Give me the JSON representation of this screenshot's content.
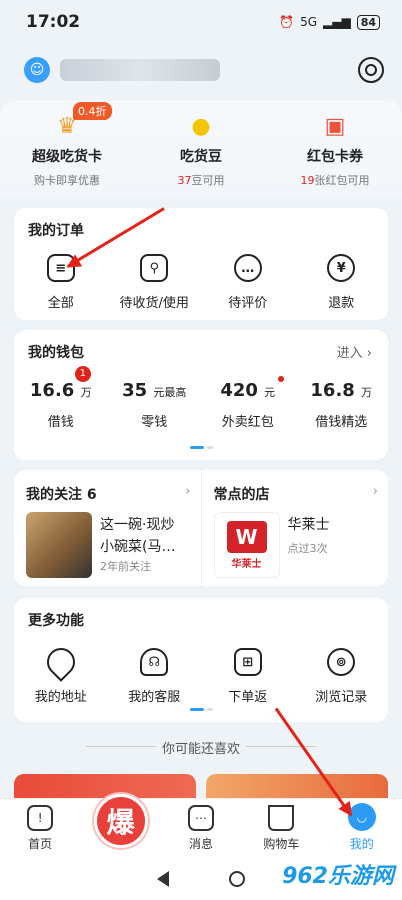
{
  "status": {
    "time": "17:02",
    "battery": "84",
    "network": "5G"
  },
  "benefits": [
    {
      "title": "超级吃货卡",
      "sub": "购卡即享优惠",
      "tag": "0.4折",
      "icon": "crown-icon",
      "glyph": "♛"
    },
    {
      "title": "吃货豆",
      "num": "37",
      "suffix": "豆可用",
      "icon": "bean-icon",
      "glyph": "●"
    },
    {
      "title": "红包卡券",
      "num": "19",
      "suffix": "张红包可用",
      "icon": "coupon-icon",
      "glyph": "▣"
    }
  ],
  "orders": {
    "title": "我的订单",
    "items": [
      {
        "label": "全部",
        "glyph": "≡",
        "icon": "order-list-icon"
      },
      {
        "label": "待收货/使用",
        "glyph": "⚲",
        "icon": "delivery-scooter-icon"
      },
      {
        "label": "待评价",
        "glyph": "…",
        "icon": "comment-icon"
      },
      {
        "label": "退款",
        "glyph": "¥",
        "icon": "refund-icon"
      }
    ]
  },
  "wallet": {
    "title": "我的钱包",
    "more": "进入 ›",
    "badge": "1",
    "items": [
      {
        "value": "16.6",
        "unit": "万",
        "label": "借钱"
      },
      {
        "value": "35",
        "unit": "元最高",
        "label": "零钱"
      },
      {
        "value": "420",
        "unit": "元",
        "label": "外卖红包"
      },
      {
        "value": "16.8",
        "unit": "万",
        "label": "借钱精选"
      }
    ]
  },
  "follow": {
    "title": "我的关注",
    "count": "6",
    "name_line1": "这一碗·现炒",
    "name_line2": "小碗菜(马…",
    "sub": "2年前关注"
  },
  "shops": {
    "title": "常点的店",
    "name": "华莱士",
    "sub": "点过3次",
    "logo": "W",
    "logo_text": "华莱士"
  },
  "functions": {
    "title": "更多功能",
    "items": [
      {
        "label": "我的地址",
        "glyph": "⌖",
        "icon": "location-pin-icon"
      },
      {
        "label": "我的客服",
        "glyph": "☊",
        "icon": "headset-icon"
      },
      {
        "label": "下单返",
        "glyph": "⊞",
        "icon": "gift-icon"
      },
      {
        "label": "浏览记录",
        "glyph": "⊚",
        "icon": "footprint-icon"
      }
    ]
  },
  "divider": "你可能还喜欢",
  "tabbar": [
    {
      "label": "首页",
      "glyph": "!",
      "icon": "home-icon"
    },
    {
      "label": "",
      "glyph": "爆",
      "icon": "hot-deal-icon"
    },
    {
      "label": "消息",
      "glyph": "⋯",
      "icon": "message-icon"
    },
    {
      "label": "购物车",
      "glyph": "⊻",
      "icon": "cart-icon"
    },
    {
      "label": "我的",
      "glyph": "◡",
      "icon": "profile-icon"
    }
  ],
  "watermark": "962乐游网"
}
